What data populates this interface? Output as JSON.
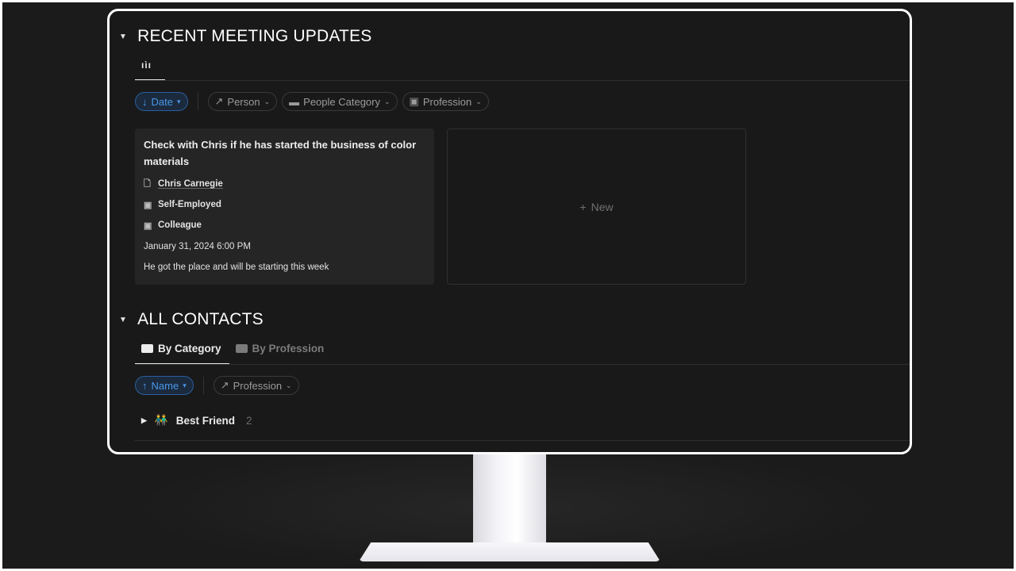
{
  "meetings": {
    "title": "RECENT MEETING UPDATES",
    "view_icon": "ıὶı",
    "filters": {
      "date": "Date",
      "person": "Person",
      "people_category": "People Category",
      "profession": "Profession"
    },
    "card": {
      "title": "Check with Chris if he has started the business of color materials",
      "person": "Chris Carnegie",
      "profession": "Self-Employed",
      "category": "Colleague",
      "date": "January 31, 2024 6:00 PM",
      "note": "He got the place and will be starting this week"
    },
    "new_label": "New"
  },
  "contacts": {
    "title": "ALL CONTACTS",
    "tabs": [
      "By Category",
      "By Profession"
    ],
    "filters": {
      "name": "Name",
      "profession": "Profession"
    },
    "groups": [
      {
        "label": "Best Friend",
        "count": "2"
      }
    ]
  },
  "colors": {
    "accent": "#4a97e8",
    "background": "#191919",
    "card": "#252525"
  }
}
